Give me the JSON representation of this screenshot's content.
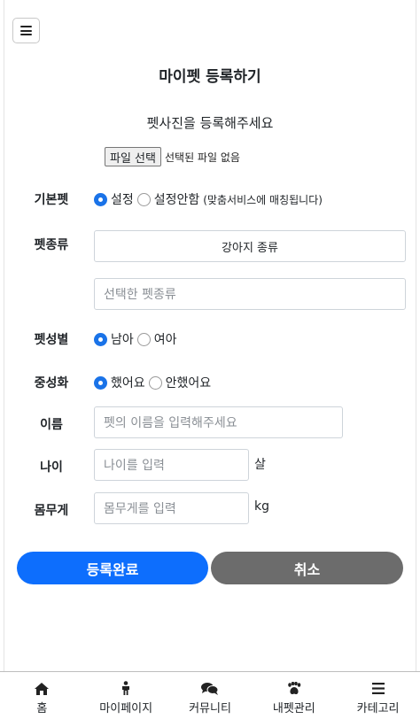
{
  "page": {
    "title": "마이펫 등록하기",
    "menu_icon": "hamburger-icon"
  },
  "photo": {
    "label": "펫사진을 등록해주세요",
    "file_button": "파일 선택",
    "file_status": "선택된 파일 없음"
  },
  "default_pet": {
    "label": "기본펫",
    "options": [
      "설정",
      "설정안함"
    ],
    "selected": "설정",
    "note": "(맞춤서비스에 매칭됩니다)"
  },
  "species": {
    "label": "펫종류",
    "dropdown_label": "강아지 종류",
    "placeholder": "선택한 펫종류"
  },
  "gender": {
    "label": "펫성별",
    "options": [
      "남아",
      "여아"
    ],
    "selected": "남아"
  },
  "neutered": {
    "label": "중성화",
    "options": [
      "했어요",
      "안했어요"
    ],
    "selected": "했어요"
  },
  "name": {
    "label": "이름",
    "placeholder": "펫의 이름을 입력해주세요"
  },
  "age": {
    "label": "나이",
    "placeholder": "나이를 입력",
    "unit": "살"
  },
  "weight": {
    "label": "몸무게",
    "placeholder": "몸무게를 입력",
    "unit": "kg"
  },
  "actions": {
    "submit": "등록완료",
    "cancel": "취소",
    "submit_color": "#0d6efd",
    "cancel_color": "#6c6c6c"
  },
  "bottom_nav": [
    {
      "label": "홈",
      "icon": "home-icon"
    },
    {
      "label": "마이페이지",
      "icon": "person-icon"
    },
    {
      "label": "커뮤니티",
      "icon": "chat-icon"
    },
    {
      "label": "내펫관리",
      "icon": "paw-icon"
    },
    {
      "label": "카테고리",
      "icon": "list-icon"
    }
  ]
}
